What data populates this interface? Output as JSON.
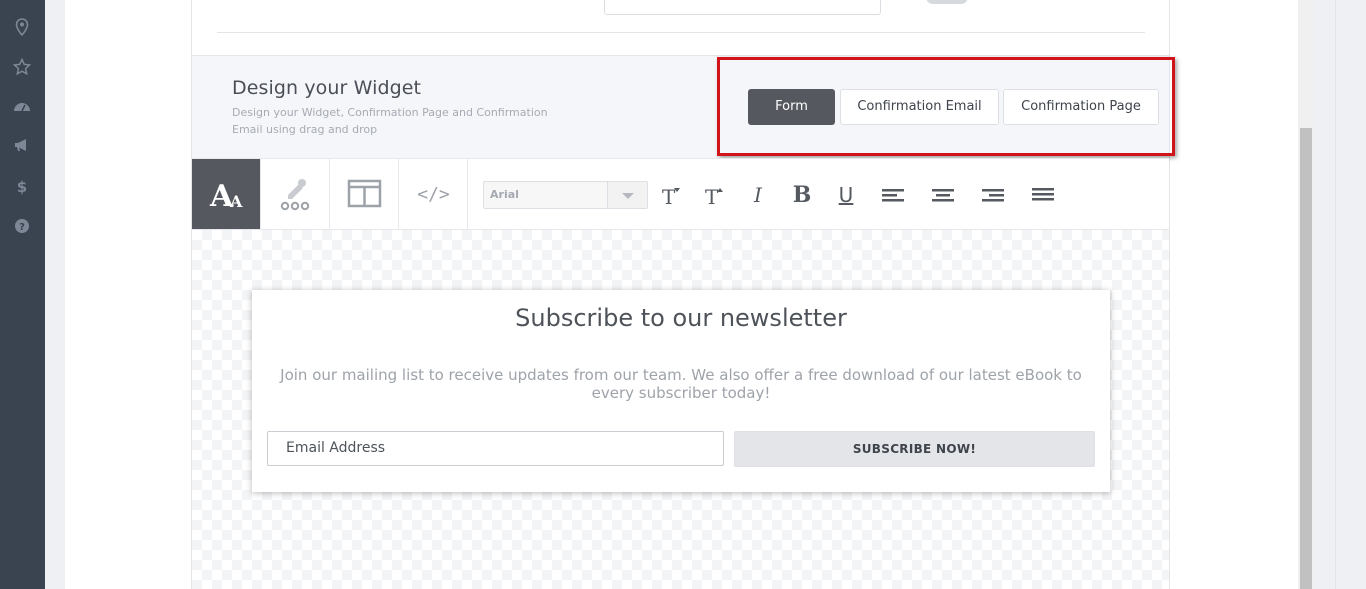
{
  "sidebar": {
    "icons": [
      {
        "name": "map-pin-icon",
        "glyph": "⌾"
      },
      {
        "name": "star-icon",
        "glyph": "☆"
      },
      {
        "name": "dashboard-icon",
        "glyph": "◔"
      },
      {
        "name": "megaphone-icon",
        "glyph": "◀"
      },
      {
        "name": "dollar-icon",
        "glyph": "$"
      },
      {
        "name": "help-icon",
        "glyph": "?"
      }
    ]
  },
  "design": {
    "title": "Design your Widget",
    "subtitle": "Design your Widget, Confirmation Page and Confirmation Email using drag and drop",
    "tabs": {
      "form": "Form",
      "confirmation_email": "Confirmation Email",
      "confirmation_page": "Confirmation Page"
    },
    "active_tab": "Form",
    "highlight_color": "#d0141a"
  },
  "toolbar": {
    "tool_tabs": [
      {
        "name": "text-style-icon",
        "active": true
      },
      {
        "name": "color-picker-icon",
        "active": false
      },
      {
        "name": "layout-icon",
        "active": false
      },
      {
        "name": "code-icon",
        "active": false
      }
    ],
    "font_value": "Arial",
    "format_buttons": {
      "decrease_size": "T▾",
      "increase_size": "T▴",
      "italic": "I",
      "bold": "B",
      "underline": "U"
    },
    "align_buttons": [
      "align-left-icon",
      "align-center-icon",
      "align-right-icon",
      "align-justify-icon"
    ]
  },
  "widget": {
    "title": "Subscribe to our newsletter",
    "text": "Join our mailing list to receive updates from our team. We also offer a free download of our latest eBook to every subscriber today!",
    "email_placeholder": "Email Address",
    "button_label": "SUBSCRIBE NOW!"
  },
  "colors": {
    "rail": "#3a4350",
    "active_dark": "#55585e",
    "canvas_check": "#f3f4f6"
  }
}
